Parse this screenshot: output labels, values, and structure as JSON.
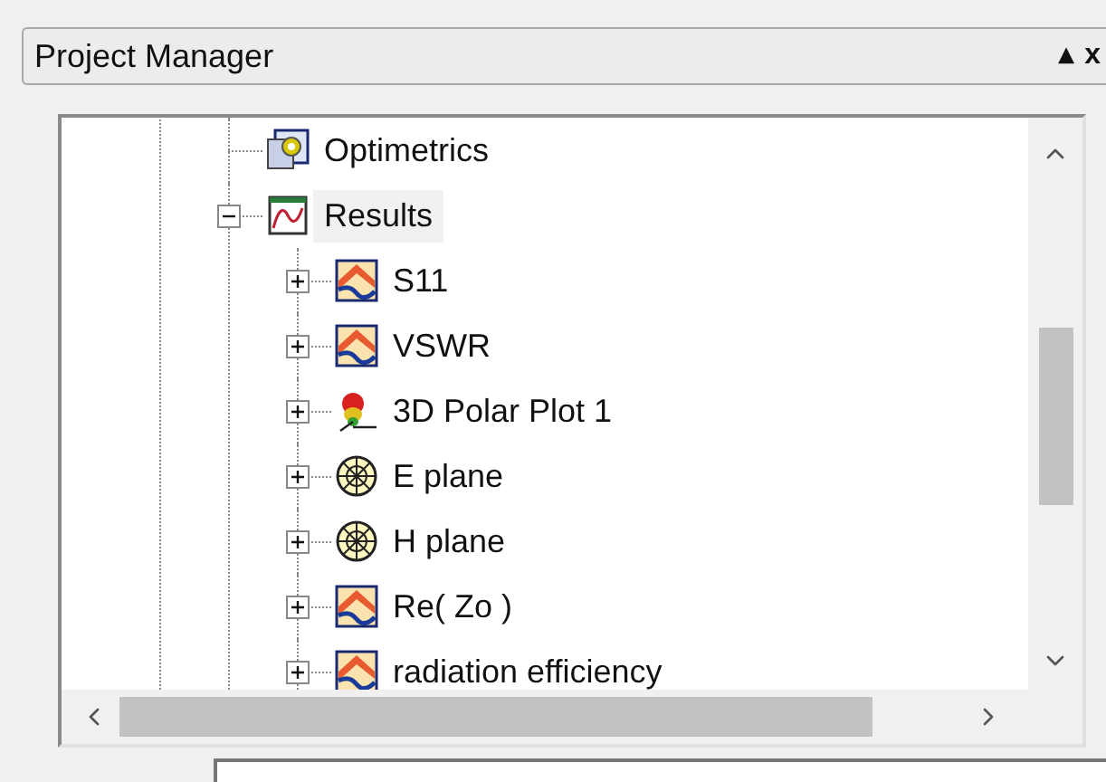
{
  "panel": {
    "title": "Project Manager",
    "buttons": [
      "▴",
      "x"
    ]
  },
  "tree": [
    {
      "label": "Optimetrics",
      "kind": "gear",
      "selected": false
    },
    {
      "label": "Results",
      "kind": "results",
      "selected": true,
      "expanded": true,
      "children": [
        {
          "label": "S11",
          "kind": "rect-plot",
          "selected": false,
          "expanded": false
        },
        {
          "label": "VSWR",
          "kind": "rect-plot",
          "selected": false,
          "expanded": false
        },
        {
          "label": "3D Polar Plot 1",
          "kind": "polar3d",
          "selected": false,
          "expanded": false
        },
        {
          "label": "E plane",
          "kind": "polar",
          "selected": false,
          "expanded": false
        },
        {
          "label": "H plane",
          "kind": "polar",
          "selected": false,
          "expanded": false
        },
        {
          "label": "Re( Zo )",
          "kind": "rect-plot",
          "selected": false,
          "expanded": false
        },
        {
          "label": "radiation efficiency",
          "kind": "rect-plot",
          "selected": false,
          "expanded": false
        }
      ]
    }
  ]
}
